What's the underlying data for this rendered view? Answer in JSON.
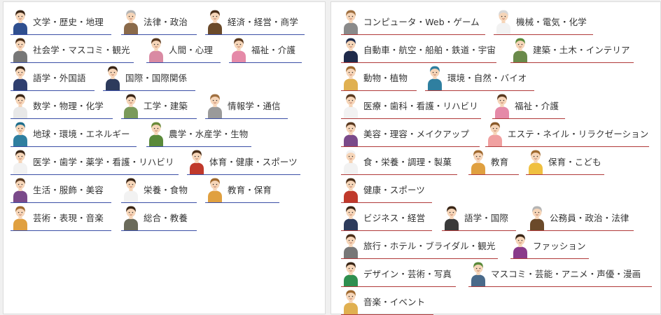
{
  "palette": {
    "skin": "#f6d5b8",
    "left_underline": "#3b4fa6",
    "right_underline": "#b03a3a"
  },
  "left_categories": [
    {
      "label": "文学・歴史・地理",
      "icon": "student-boy-icon",
      "hair": "#3a2616",
      "shirt": "#2f4f8f"
    },
    {
      "label": "法律・政治",
      "icon": "gray-haired-lawyer-icon",
      "hair": "#b5b5b5",
      "shirt": "#8a6a4a"
    },
    {
      "label": "経済・経営・商学",
      "icon": "businessman-icon",
      "hair": "#4a2e18",
      "shirt": "#6b4a2a"
    },
    {
      "label": "社会学・マスコミ・観光",
      "icon": "reporter-icon",
      "hair": "#4a2e18",
      "shirt": "#777777"
    },
    {
      "label": "人間・心理",
      "icon": "woman-heart-icon",
      "hair": "#5a3a20",
      "shirt": "#d98aa3"
    },
    {
      "label": "福祉・介護",
      "icon": "caregiver-icon",
      "hair": "#5a3a20",
      "shirt": "#e58aa8"
    },
    {
      "label": "語学・外国語",
      "icon": "language-speaker-icon",
      "hair": "#3a2616",
      "shirt": "#2f3f6f"
    },
    {
      "label": "国際・国際関係",
      "icon": "globe-holder-icon",
      "hair": "#3a2616",
      "shirt": "#2d3b5c"
    },
    {
      "label": "数学・物理・化学",
      "icon": "scientist-icon",
      "hair": "#3a2616",
      "shirt": "#e8e8e8"
    },
    {
      "label": "工学・建築",
      "icon": "engineer-icon",
      "hair": "#3a2616",
      "shirt": "#7a9a5a"
    },
    {
      "label": "情報学・通信",
      "icon": "computer-user-icon",
      "hair": "#a07040",
      "shirt": "#9a9a9a"
    },
    {
      "label": "地球・環境・エネルギー",
      "icon": "environment-worker-icon",
      "hair": "#1e6e8c",
      "shirt": "#2f7fa0"
    },
    {
      "label": "農学・水産学・生物",
      "icon": "farmer-icon",
      "hair": "#6a8a3a",
      "shirt": "#5a8a3a"
    },
    {
      "label": "医学・歯学・薬学・看護・リハビリ",
      "icon": "doctor-icon",
      "hair": "#3a2616",
      "shirt": "#f2f2f2"
    },
    {
      "label": "体育・健康・スポーツ",
      "icon": "athlete-icon",
      "hair": "#4a2e18",
      "shirt": "#c0392b"
    },
    {
      "label": "生活・服飾・美容",
      "icon": "fashion-woman-icon",
      "hair": "#5a3a20",
      "shirt": "#7a4a8a"
    },
    {
      "label": "栄養・食物",
      "icon": "nutritionist-icon",
      "hair": "#3a2616",
      "shirt": "#f2f2f2"
    },
    {
      "label": "教育・保育",
      "icon": "teacher-icon",
      "hair": "#a06a30",
      "shirt": "#e0a040"
    },
    {
      "label": "芸術・表現・音楽",
      "icon": "musician-icon",
      "hair": "#a06a30",
      "shirt": "#e0a040"
    },
    {
      "label": "総合・教養",
      "icon": "thinker-icon",
      "hair": "#3a2616",
      "shirt": "#6a6a5a"
    }
  ],
  "right_categories": [
    {
      "label": "コンピュータ・Web・ゲーム",
      "icon": "programmer-icon",
      "hair": "#a07040",
      "shirt": "#8a8a8a"
    },
    {
      "label": "機械・電気・化学",
      "icon": "lab-worker-icon",
      "hair": "#d8d8d8",
      "shirt": "#f2f2f2"
    },
    {
      "label": "自動車・航空・船舶・鉄道・宇宙",
      "icon": "pilot-icon",
      "hair": "#1f2a4a",
      "shirt": "#1f2a4a"
    },
    {
      "label": "建築・土木・インテリア",
      "icon": "construction-worker-icon",
      "hair": "#5a8a3a",
      "shirt": "#6a8a4a"
    },
    {
      "label": "動物・植物",
      "icon": "animal-caretaker-icon",
      "hair": "#a06a30",
      "shirt": "#e0b050"
    },
    {
      "label": "環境・自然・バイオ",
      "icon": "nature-worker-icon",
      "hair": "#2f7fa0",
      "shirt": "#2f7fa0"
    },
    {
      "label": "医療・歯科・看護・リハビリ",
      "icon": "nurse-icon",
      "hair": "#5a3a20",
      "shirt": "#f2f2f2"
    },
    {
      "label": "福祉・介護",
      "icon": "caregiver-icon",
      "hair": "#5a3a20",
      "shirt": "#e58aa8"
    },
    {
      "label": "美容・理容・メイクアップ",
      "icon": "stylist-icon",
      "hair": "#5a3a20",
      "shirt": "#7a4a8a"
    },
    {
      "label": "エステ・ネイル・リラクゼーション",
      "icon": "esthetician-icon",
      "hair": "#8a5a2a",
      "shirt": "#f0a0a0"
    },
    {
      "label": "食・栄養・調理・製菓",
      "icon": "chef-icon",
      "hair": "#f2f2f2",
      "shirt": "#f2f2f2"
    },
    {
      "label": "教育",
      "icon": "teacher-icon",
      "hair": "#a06a30",
      "shirt": "#e0a040"
    },
    {
      "label": "保育・こども",
      "icon": "childcare-worker-icon",
      "hair": "#a06a30",
      "shirt": "#f0c040"
    },
    {
      "label": "健康・スポーツ",
      "icon": "athlete-icon",
      "hair": "#4a2e18",
      "shirt": "#c0392b"
    },
    {
      "label": "ビジネス・経営",
      "icon": "business-phone-icon",
      "hair": "#3a2616",
      "shirt": "#2d3b5c"
    },
    {
      "label": "語学・国際",
      "icon": "language-speaker-icon",
      "hair": "#3a2616",
      "shirt": "#3a3a3a"
    },
    {
      "label": "公務員・政治・法律",
      "icon": "civil-servant-icon",
      "hair": "#b5b5b5",
      "shirt": "#6b4a2a"
    },
    {
      "label": "旅行・ホテル・ブライダル・観光",
      "icon": "tour-guide-icon",
      "hair": "#4a2e18",
      "shirt": "#777777"
    },
    {
      "label": "ファッション",
      "icon": "fashion-woman-icon",
      "hair": "#3a2616",
      "shirt": "#8a3a8a"
    },
    {
      "label": "デザイン・芸術・写真",
      "icon": "designer-icon",
      "hair": "#3a2616",
      "shirt": "#2f8f4f"
    },
    {
      "label": "マスコミ・芸能・アニメ・声優・漫画",
      "icon": "media-person-icon",
      "hair": "#5a8a3a",
      "shirt": "#4a6a8a"
    },
    {
      "label": "音楽・イベント",
      "icon": "singer-icon",
      "hair": "#a06a30",
      "shirt": "#e0b050"
    }
  ]
}
